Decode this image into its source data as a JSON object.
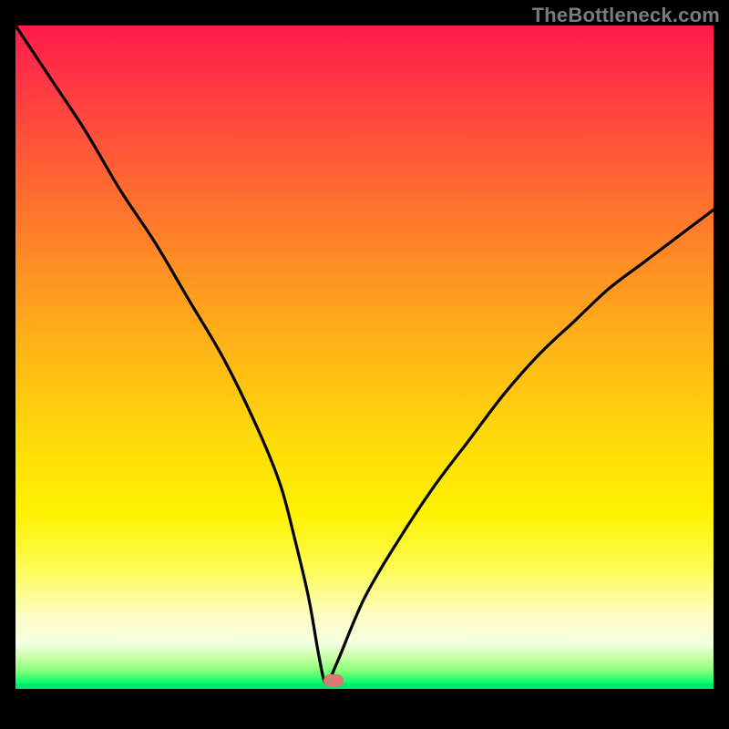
{
  "watermark": "TheBottleneck.com",
  "chart_data": {
    "type": "line",
    "title": "",
    "xlabel": "",
    "ylabel": "",
    "ylim": [
      0,
      100
    ],
    "xlim": [
      0,
      100
    ],
    "x": [
      0,
      5,
      10,
      15,
      20,
      25,
      30,
      35,
      38,
      40,
      42,
      43.5,
      44.5,
      46,
      50,
      55,
      60,
      65,
      70,
      75,
      80,
      85,
      90,
      95,
      100
    ],
    "values": [
      100,
      92,
      84,
      75,
      67,
      58,
      49,
      38,
      30,
      22,
      13,
      4,
      0,
      3,
      13,
      22,
      30,
      37,
      44,
      50,
      55,
      60,
      64,
      68,
      72
    ],
    "notch_x": 44.5,
    "marker": {
      "x_pct": 45.6,
      "y_from_bottom_pct": 0.1
    },
    "gradient_note": "red at top → orange → yellow → green at bottom"
  }
}
